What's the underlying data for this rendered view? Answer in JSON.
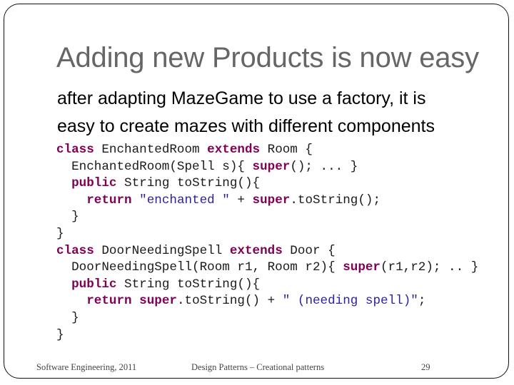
{
  "slide": {
    "title": "Adding new Products is now easy",
    "subtitle_lines": [
      "after adapting MazeGame to use a factory, it is",
      "easy to create mazes with different components"
    ],
    "code_lines": [
      [
        {
          "t": "kw",
          "v": "class"
        },
        {
          "t": "plain",
          "v": " EnchantedRoom "
        },
        {
          "t": "kw",
          "v": "extends"
        },
        {
          "t": "plain",
          "v": " Room {"
        }
      ],
      [
        {
          "t": "plain",
          "v": "  EnchantedRoom(Spell s){ "
        },
        {
          "t": "kw",
          "v": "super"
        },
        {
          "t": "plain",
          "v": "(); ... }"
        }
      ],
      [
        {
          "t": "plain",
          "v": "  "
        },
        {
          "t": "kw",
          "v": "public"
        },
        {
          "t": "plain",
          "v": " String toString(){"
        }
      ],
      [
        {
          "t": "plain",
          "v": "    "
        },
        {
          "t": "kw",
          "v": "return"
        },
        {
          "t": "plain",
          "v": " "
        },
        {
          "t": "str",
          "v": "\"enchanted \""
        },
        {
          "t": "plain",
          "v": " + "
        },
        {
          "t": "kw",
          "v": "super"
        },
        {
          "t": "plain",
          "v": ".toString();"
        }
      ],
      [
        {
          "t": "plain",
          "v": "  }"
        }
      ],
      [
        {
          "t": "plain",
          "v": "}"
        }
      ],
      [
        {
          "t": "kw",
          "v": "class"
        },
        {
          "t": "plain",
          "v": " DoorNeedingSpell "
        },
        {
          "t": "kw",
          "v": "extends"
        },
        {
          "t": "plain",
          "v": " Door {"
        }
      ],
      [
        {
          "t": "plain",
          "v": "  DoorNeedingSpell(Room r1, Room r2){ "
        },
        {
          "t": "kw",
          "v": "super"
        },
        {
          "t": "plain",
          "v": "(r1,r2); .. }"
        }
      ],
      [
        {
          "t": "plain",
          "v": "  "
        },
        {
          "t": "kw",
          "v": "public"
        },
        {
          "t": "plain",
          "v": " String toString(){"
        }
      ],
      [
        {
          "t": "plain",
          "v": "    "
        },
        {
          "t": "kw",
          "v": "return"
        },
        {
          "t": "plain",
          "v": " "
        },
        {
          "t": "kw",
          "v": "super"
        },
        {
          "t": "plain",
          "v": ".toString() + "
        },
        {
          "t": "str",
          "v": "\" (needing spell)\""
        },
        {
          "t": "plain",
          "v": ";"
        }
      ],
      [
        {
          "t": "plain",
          "v": "  }"
        }
      ],
      [
        {
          "t": "plain",
          "v": "}"
        }
      ]
    ]
  },
  "footer": {
    "course": "Software Engineering, 2011",
    "topic": "Design Patterns – Creational patterns",
    "page_number": "29"
  },
  "colors": {
    "title": "#666666",
    "keyword": "#7f0055",
    "string": "#2a1fa0",
    "code_text": "#1a1a1a",
    "footer": "#444444"
  }
}
